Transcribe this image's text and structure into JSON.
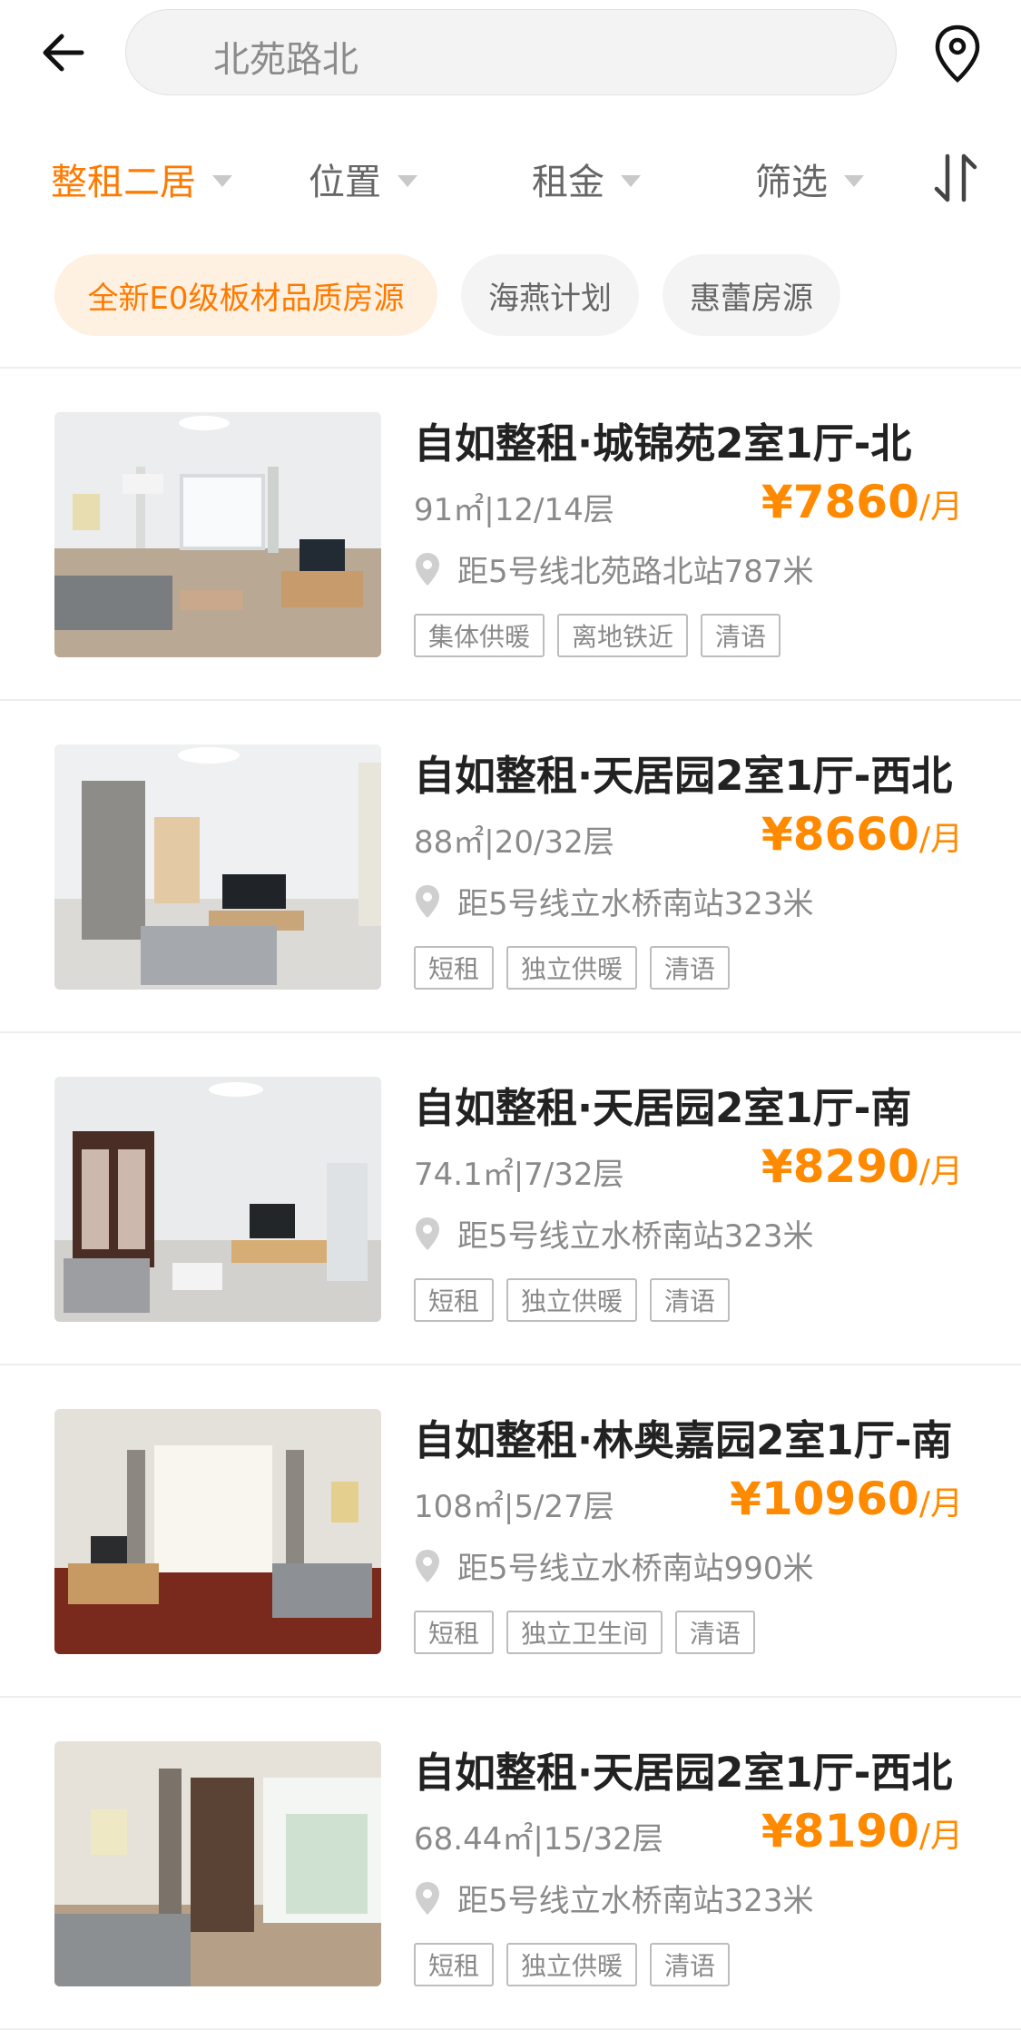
{
  "search": {
    "text": "北苑路北"
  },
  "filters": {
    "tabs": [
      {
        "label": "整租二居",
        "active": true
      },
      {
        "label": "位置",
        "active": false
      },
      {
        "label": "租金",
        "active": false
      },
      {
        "label": "筛选",
        "active": false
      }
    ]
  },
  "chips": [
    {
      "label": "全新E0级板材品质房源",
      "highlighted": true
    },
    {
      "label": "海燕计划",
      "highlighted": false
    },
    {
      "label": "惠蕾房源",
      "highlighted": false
    }
  ],
  "listings": [
    {
      "title": "自如整租·城锦苑2室1厅-北",
      "meta": "91㎡|12/14层",
      "price": "¥7860",
      "unit": "/月",
      "distance": "距5号线北苑路北站787米",
      "tags": [
        "集体供暖",
        "离地铁近",
        "清语"
      ]
    },
    {
      "title": "自如整租·天居园2室1厅-西北",
      "meta": "88㎡|20/32层",
      "price": "¥8660",
      "unit": "/月",
      "distance": "距5号线立水桥南站323米",
      "tags": [
        "短租",
        "独立供暖",
        "清语"
      ]
    },
    {
      "title": "自如整租·天居园2室1厅-南",
      "meta": "74.1㎡|7/32层",
      "price": "¥8290",
      "unit": "/月",
      "distance": "距5号线立水桥南站323米",
      "tags": [
        "短租",
        "独立供暖",
        "清语"
      ]
    },
    {
      "title": "自如整租·林奥嘉园2室1厅-南",
      "meta": "108㎡|5/27层",
      "price": "¥10960",
      "unit": "/月",
      "distance": "距5号线立水桥南站990米",
      "tags": [
        "短租",
        "独立卫生间",
        "清语"
      ]
    },
    {
      "title": "自如整租·天居园2室1厅-西北",
      "meta": "68.44㎡|15/32层",
      "price": "¥8190",
      "unit": "/月",
      "distance": "距5号线立水桥南站323米",
      "tags": [
        "短租",
        "独立供暖",
        "清语"
      ]
    }
  ],
  "colors": {
    "accent": "#ff7a00",
    "price": "#ff8a00",
    "chip_bg": "#fff1e2"
  }
}
